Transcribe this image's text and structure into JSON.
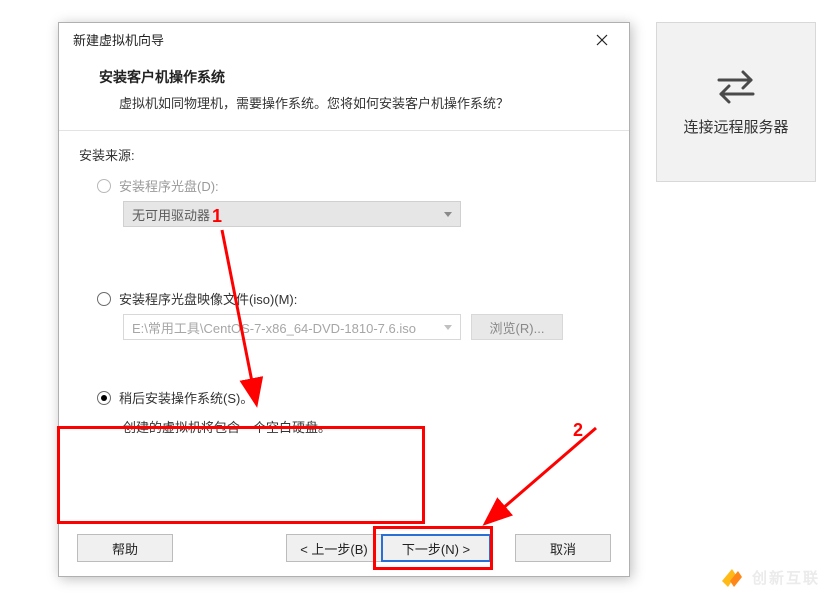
{
  "background_tile": {
    "label": "连接远程服务器"
  },
  "dialog": {
    "title": "新建虚拟机向导",
    "heading": "安装客户机操作系统",
    "description": "虚拟机如同物理机，需要操作系统。您将如何安装客户机操作系统？",
    "section_label": "安装来源:",
    "option_disc": {
      "label": "安装程序光盘(D):",
      "dropdown_value": "无可用驱动器"
    },
    "option_iso": {
      "label": "安装程序光盘映像文件(iso)(M):",
      "field_value": "E:\\常用工具\\CentOS-7-x86_64-DVD-1810-7.6.iso",
      "browse_label": "浏览(R)..."
    },
    "option_later": {
      "label": "稍后安装操作系统(S)。",
      "description": "创建的虚拟机将包含一个空白硬盘。"
    },
    "buttons": {
      "help": "帮助",
      "back": "< 上一步(B)",
      "next": "下一步(N) >",
      "cancel": "取消"
    }
  },
  "annotations": {
    "num1": "1",
    "num2": "2"
  },
  "logo_text": "创新互联"
}
